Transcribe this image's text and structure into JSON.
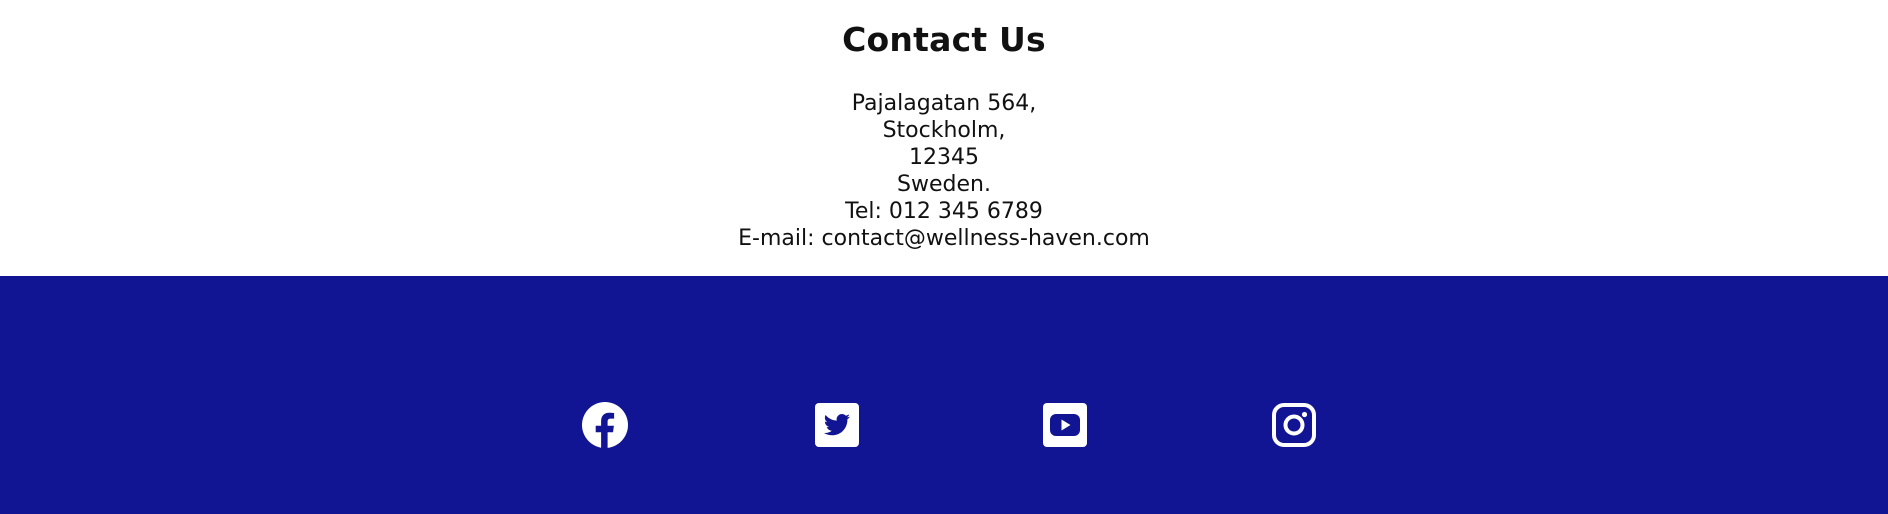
{
  "contact": {
    "title": "Contact Us",
    "address_line_1": "Pajalagatan 564,",
    "address_line_2": "Stockholm,",
    "address_line_3": "12345",
    "address_line_4": "Sweden.",
    "tel": "Tel: 012 345 6789",
    "email": "E-mail: contact@wellness-haven.com"
  },
  "footer": {
    "background_color": "#111594",
    "icon_color": "#ffffff",
    "social_icons": [
      "facebook-icon",
      "twitter-icon",
      "youtube-icon",
      "instagram-icon"
    ]
  }
}
